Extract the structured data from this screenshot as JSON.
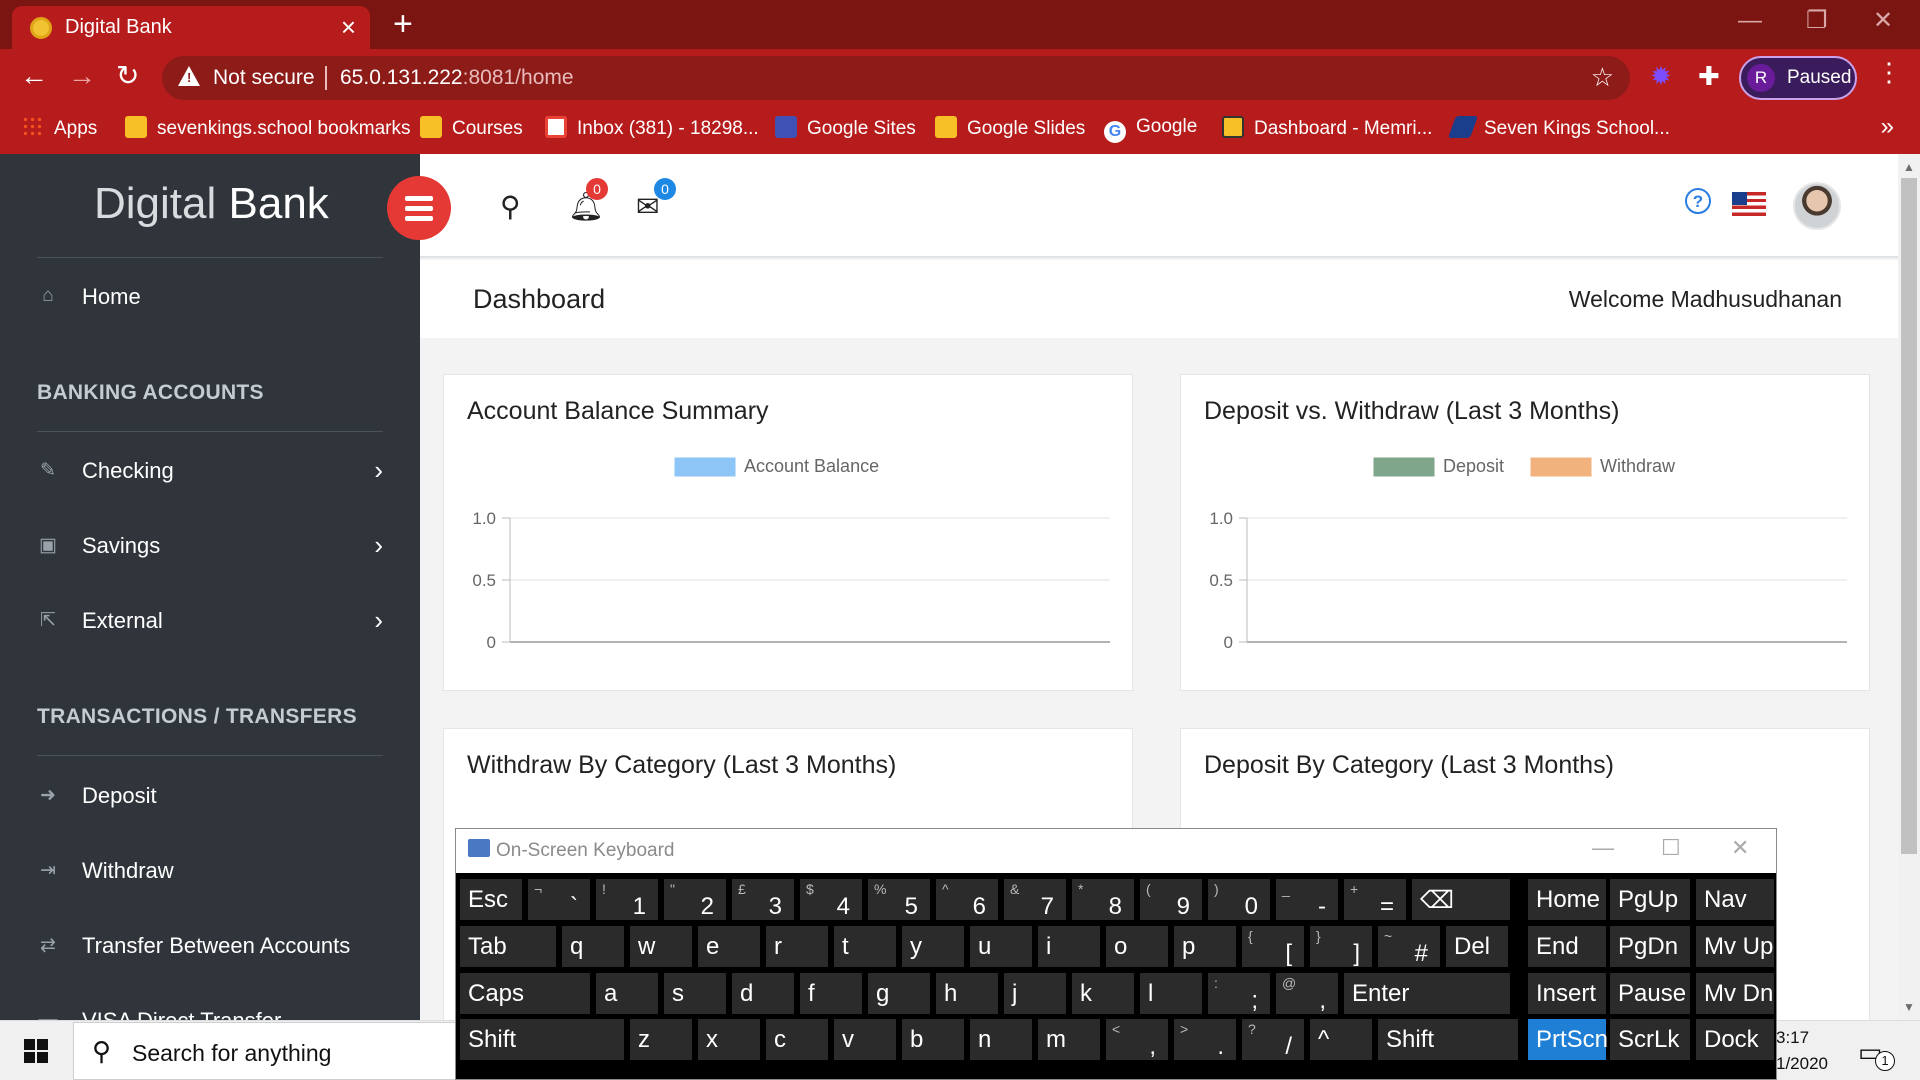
{
  "browser": {
    "tab_title": "Digital Bank",
    "tab_close": "×",
    "new_tab": "+",
    "not_secure": "Not secure",
    "url_host": "65.0.131.222",
    "url_rest": ":8081/home",
    "profile_initial": "R",
    "profile_status": "Paused",
    "more_bookmarks": "»",
    "bookmarks": [
      {
        "label": "Apps",
        "color": "#f4511e"
      },
      {
        "label": "sevenkings.school bookmarks",
        "color": "#f6c026"
      },
      {
        "label": "Courses",
        "color": "#f6c026"
      },
      {
        "label": "Inbox (381) - 18298...",
        "color": "#ea4335"
      },
      {
        "label": "Google Sites",
        "color": "#3f51b5"
      },
      {
        "label": "Google Slides",
        "color": "#f6c026"
      },
      {
        "label": "Google",
        "color": "#ffffff"
      },
      {
        "label": "Dashboard - Memri...",
        "color": "#f6c026"
      },
      {
        "label": "Seven Kings School...",
        "color": "#1a3e8c"
      }
    ]
  },
  "sidebar": {
    "brand_light": "Digital",
    "brand_bold": "Bank",
    "home": "Home",
    "section_banking": "BANKING ACCOUNTS",
    "checking": "Checking",
    "savings": "Savings",
    "external": "External",
    "section_transactions": "TRANSACTIONS / TRANSFERS",
    "deposit": "Deposit",
    "withdraw": "Withdraw",
    "transfer": "Transfer Between Accounts",
    "visa": "VISA Direct Transfer"
  },
  "topnav": {
    "notifications_count": "0",
    "messages_count": "0"
  },
  "header": {
    "title": "Dashboard",
    "welcome": "Welcome Madhusudhanan"
  },
  "cards": {
    "balance_title": "Account Balance Summary",
    "deposit_withdraw_title": "Deposit vs. Withdraw (Last 3 Months)",
    "withdraw_category_title": "Withdraw By Category (Last 3 Months)",
    "deposit_category_title": "Deposit By Category (Last 3 Months)"
  },
  "chart_data": [
    {
      "type": "bar",
      "title": "Account Balance Summary",
      "categories": [],
      "series": [
        {
          "name": "Account Balance",
          "values": [],
          "color": "#8ec5f7"
        }
      ],
      "yticks": [
        "1.0",
        "0.5",
        "0"
      ],
      "ylim": [
        0,
        1
      ],
      "legend": "top-center",
      "grid": true
    },
    {
      "type": "bar",
      "title": "Deposit vs. Withdraw (Last 3 Months)",
      "categories": [],
      "series": [
        {
          "name": "Deposit",
          "values": [],
          "color": "#7fa68a"
        },
        {
          "name": "Withdraw",
          "values": [],
          "color": "#f1b27e"
        }
      ],
      "yticks": [
        "1.0",
        "0.5",
        "0"
      ],
      "ylim": [
        0,
        1
      ],
      "legend": "top-center",
      "grid": true
    }
  ],
  "osk": {
    "title": "On-Screen Keyboard",
    "rows": [
      [
        {
          "main": "Esc"
        },
        {
          "sub": "¬",
          "main": "`"
        },
        {
          "sub": "!",
          "main": "1"
        },
        {
          "sub": "\"",
          "main": "2"
        },
        {
          "sub": "£",
          "main": "3"
        },
        {
          "sub": "$",
          "main": "4"
        },
        {
          "sub": "%",
          "main": "5"
        },
        {
          "sub": "^",
          "main": "6"
        },
        {
          "sub": "&",
          "main": "7"
        },
        {
          "sub": "*",
          "main": "8"
        },
        {
          "sub": "(",
          "main": "9"
        },
        {
          "sub": ")",
          "main": "0"
        },
        {
          "sub": "_",
          "main": "-"
        },
        {
          "sub": "+",
          "main": "="
        },
        {
          "main": "⌫"
        },
        {
          "main": "Home"
        },
        {
          "main": "PgUp"
        },
        {
          "main": "Nav"
        }
      ],
      [
        {
          "main": "Tab"
        },
        {
          "main": "q"
        },
        {
          "main": "w"
        },
        {
          "main": "e"
        },
        {
          "main": "r"
        },
        {
          "main": "t"
        },
        {
          "main": "y"
        },
        {
          "main": "u"
        },
        {
          "main": "i"
        },
        {
          "main": "o"
        },
        {
          "main": "p"
        },
        {
          "sub": "{",
          "main": "["
        },
        {
          "sub": "}",
          "main": "]"
        },
        {
          "sub": "~",
          "main": "#"
        },
        {
          "main": "Del"
        },
        {
          "main": "End"
        },
        {
          "main": "PgDn"
        },
        {
          "main": "Mv Up"
        }
      ],
      [
        {
          "main": "Caps"
        },
        {
          "main": "a"
        },
        {
          "main": "s"
        },
        {
          "main": "d"
        },
        {
          "main": "f"
        },
        {
          "main": "g"
        },
        {
          "main": "h"
        },
        {
          "main": "j"
        },
        {
          "main": "k"
        },
        {
          "main": "l"
        },
        {
          "sub": ":",
          "main": ";"
        },
        {
          "sub": "@",
          "main": ","
        },
        {
          "main": "Enter"
        },
        {
          "main": "Insert"
        },
        {
          "main": "Pause"
        },
        {
          "main": "Mv Dn"
        }
      ],
      [
        {
          "main": "Shift"
        },
        {
          "main": "z"
        },
        {
          "main": "x"
        },
        {
          "main": "c"
        },
        {
          "main": "v"
        },
        {
          "main": "b"
        },
        {
          "main": "n"
        },
        {
          "main": "m"
        },
        {
          "sub": "<",
          "main": ","
        },
        {
          "sub": ">",
          "main": "."
        },
        {
          "sub": "?",
          "main": "/"
        },
        {
          "main": "^"
        },
        {
          "main": "Shift"
        },
        {
          "main": "PrtScn"
        },
        {
          "main": "ScrLk"
        },
        {
          "main": "Dock"
        }
      ]
    ]
  },
  "taskbar": {
    "search_placeholder": "Search for anything",
    "time": "3:17",
    "date": "1/2020",
    "notification_count": "1"
  }
}
